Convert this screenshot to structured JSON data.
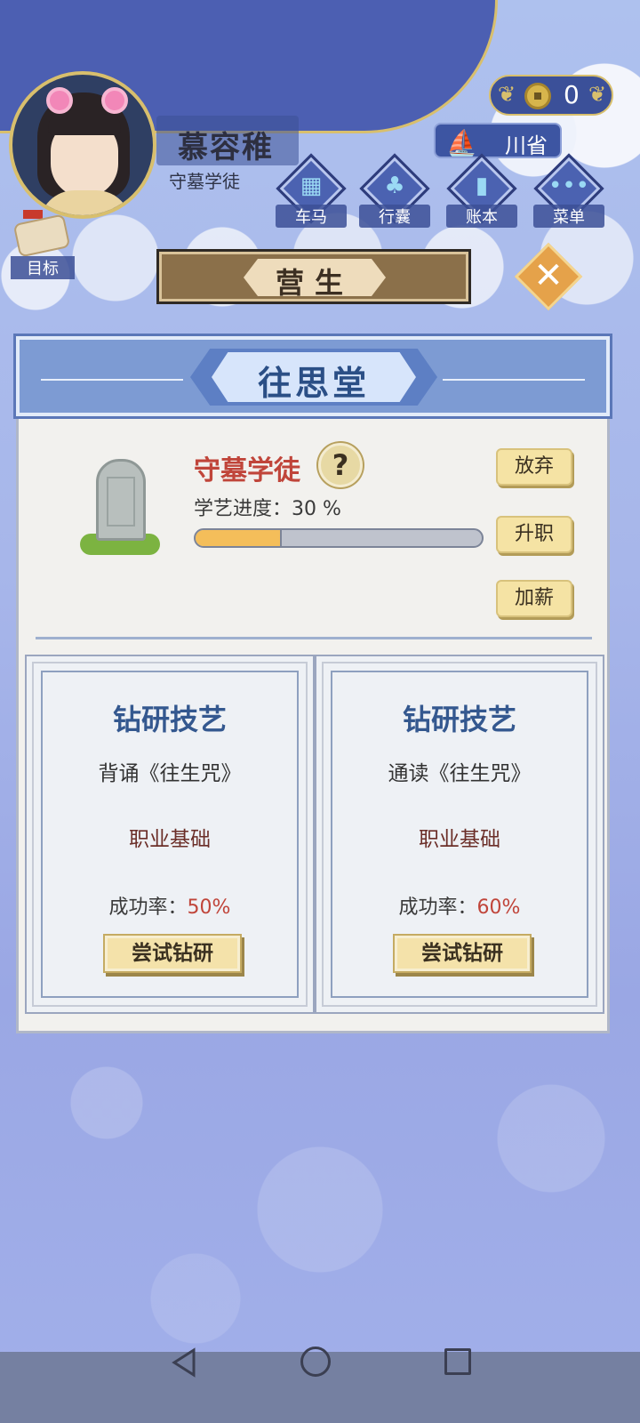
{
  "player": {
    "name": "慕容稚",
    "title": "守墓学徒"
  },
  "currency": {
    "coins": "0"
  },
  "region": {
    "label": "川省"
  },
  "nav": {
    "items": [
      {
        "label": "车马",
        "icon": "carriage-icon"
      },
      {
        "label": "行囊",
        "icon": "bag-icon"
      },
      {
        "label": "账本",
        "icon": "ledger-icon"
      },
      {
        "label": "菜单",
        "icon": "menu-icon"
      }
    ]
  },
  "goal": {
    "label": "目标"
  },
  "section": {
    "title": "营生"
  },
  "hall": {
    "title": "往思堂"
  },
  "job": {
    "title": "守墓学徒",
    "progress_label": "学艺进度：30 %",
    "progress": 0.3,
    "actions": [
      "放弃",
      "升职",
      "加薪"
    ]
  },
  "study_cards": [
    {
      "title": "钻研技艺",
      "subject": "背诵《往生咒》",
      "requirement": "职业基础",
      "rate_label": "成功率：",
      "rate_value": "50%",
      "button": "尝试钻研"
    },
    {
      "title": "钻研技艺",
      "subject": "通读《往生咒》",
      "requirement": "职业基础",
      "rate_label": "成功率：",
      "rate_value": "60%",
      "button": "尝试钻研"
    }
  ],
  "colors": {
    "accent_red": "#c0453a",
    "title_blue": "#34588f",
    "gold": "#d8bf6d"
  }
}
